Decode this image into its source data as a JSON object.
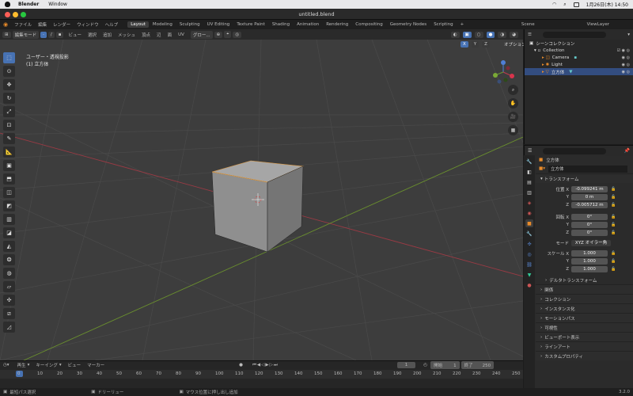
{
  "macbar": {
    "app": "Blender",
    "window": "Window",
    "date": "1月26日(木) 14:50"
  },
  "window": {
    "title": "untitled.blend"
  },
  "menus": [
    "ファイル",
    "編集",
    "レンダー",
    "ウィンドウ",
    "ヘルプ"
  ],
  "workspaces": [
    "Layout",
    "Modeling",
    "Sculpting",
    "UV Editing",
    "Texture Paint",
    "Shading",
    "Animation",
    "Rendering",
    "Compositing",
    "Geometry Nodes",
    "Scripting"
  ],
  "scene": {
    "label": "Scene",
    "viewlayer": "ViewLayer"
  },
  "vphead": {
    "mode": "編集モード",
    "items": [
      "ビュー",
      "選択",
      "追加",
      "メッシュ",
      "頂点",
      "辺",
      "面",
      "UV"
    ],
    "transform": "グロー...",
    "options": "オプション"
  },
  "axes": [
    "X",
    "Y",
    "Z"
  ],
  "overlay": {
    "line1": "ユーザー・透視投影",
    "line2": "(1) 立方体"
  },
  "outliner": {
    "root": "シーンコレクション",
    "rows": [
      "Collection",
      "Camera",
      "Light",
      "立方体"
    ]
  },
  "props": {
    "object": "立方体",
    "mesh": "立方体",
    "transform_title": "トランスフォーム",
    "location_label": "位置",
    "rotation_label": "回転",
    "scale_label": "スケール",
    "axis_x": "X",
    "axis_y": "Y",
    "axis_z": "Z",
    "loc": [
      "-0.099241 m",
      "0 m",
      "-0.005712 m"
    ],
    "rot": [
      "0°",
      "0°",
      "0°"
    ],
    "mode_label": "モード",
    "mode_value": "XYZ オイラー角",
    "scale": [
      "1.000",
      "1.000",
      "1.000"
    ],
    "delta": "デルタトランスフォーム",
    "sections": [
      "関係",
      "コレクション",
      "インスタンス化",
      "モーションパス",
      "可視性",
      "ビューポート表示",
      "ラインアート",
      "カスタムプロパティ"
    ]
  },
  "timeline": {
    "menus": [
      "再生",
      "キーイング",
      "ビュー",
      "マーカー"
    ],
    "current": "1",
    "start_label": "開始",
    "start": "1",
    "end_label": "終了",
    "end": "250",
    "ticks": [
      "0",
      "10",
      "20",
      "30",
      "40",
      "50",
      "60",
      "70",
      "80",
      "90",
      "100",
      "110",
      "120",
      "130",
      "140",
      "150",
      "160",
      "170",
      "180",
      "190",
      "200",
      "210",
      "220",
      "230",
      "240",
      "250"
    ]
  },
  "status": {
    "left": "最短パス選択",
    "mid": "ドリーリュー",
    "right": "マウス位置に押し出し追加",
    "version": "3.2.0"
  }
}
